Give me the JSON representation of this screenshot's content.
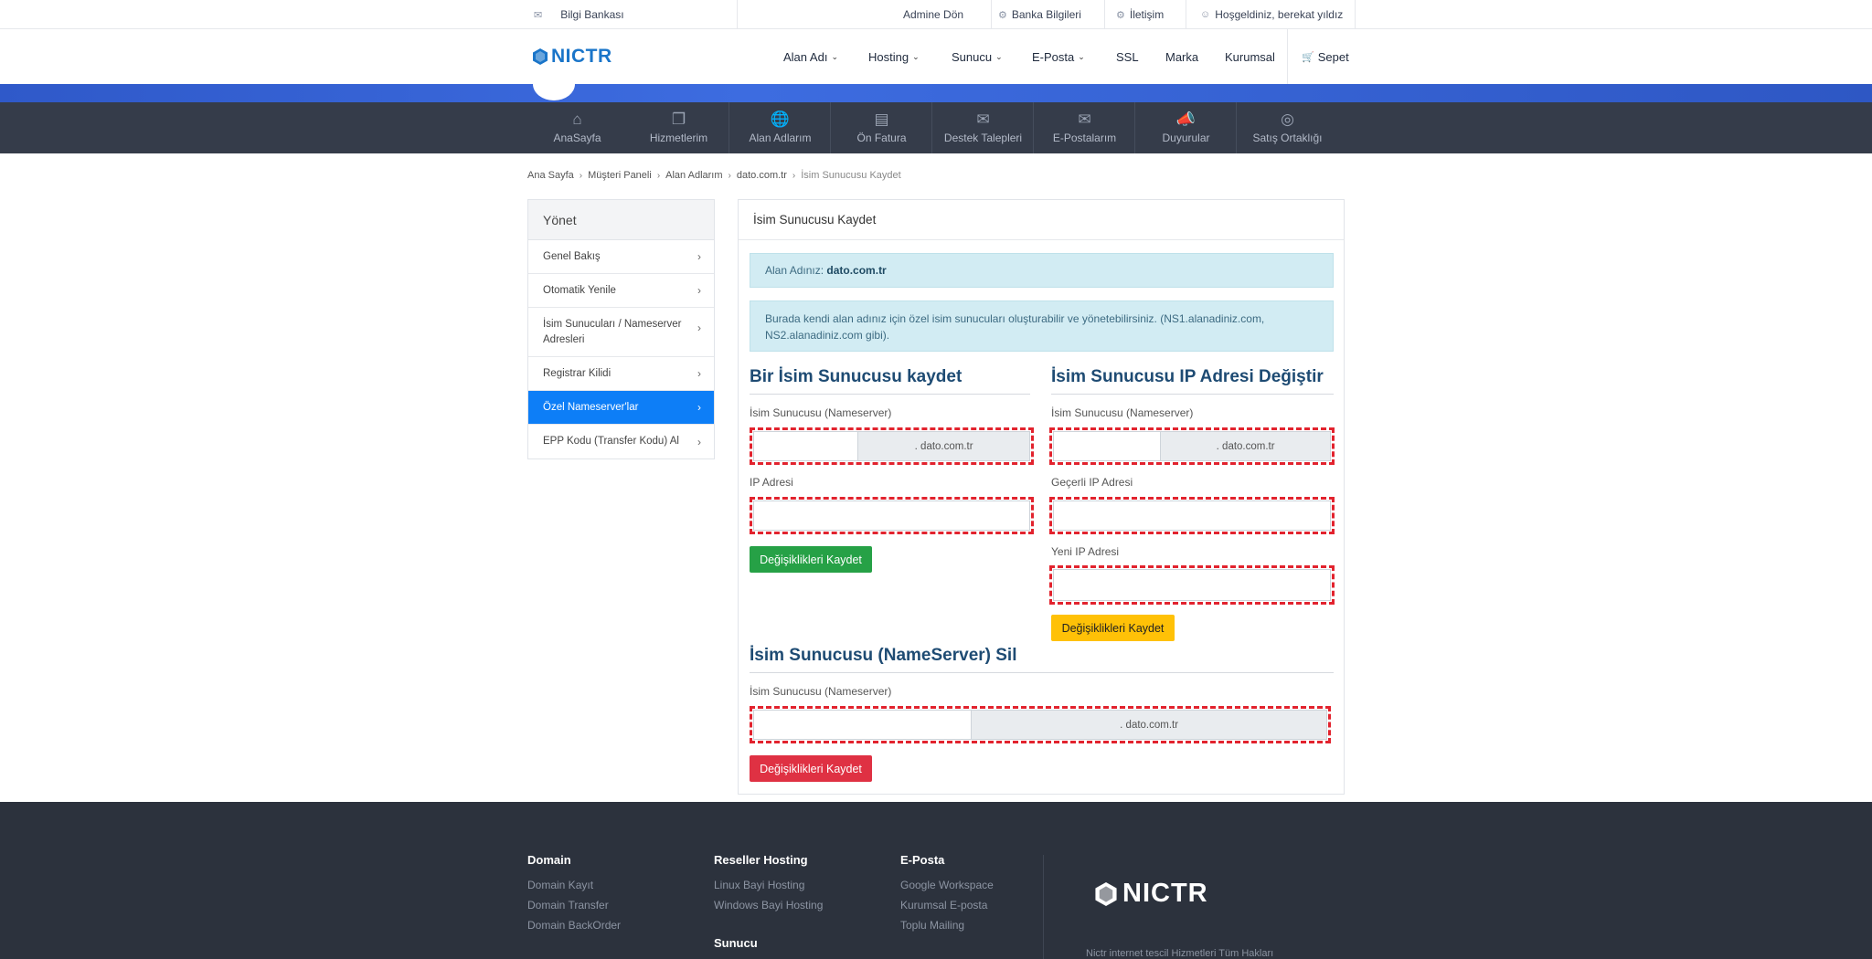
{
  "topbar": {
    "knowledge_base": "Bilgi Bankası",
    "admin_return": "Admine Dön",
    "bank_info": "Banka Bilgileri",
    "contact": "İletişim",
    "welcome": "Hoşgeldiniz, berekat yıldız"
  },
  "header": {
    "logo": "NICTR",
    "nav": [
      "Alan Adı",
      "Hosting",
      "Sunucu",
      "E-Posta",
      "SSL",
      "Marka",
      "Kurumsal"
    ],
    "cart": "Sepet"
  },
  "panel_nav": [
    {
      "label": "AnaSayfa",
      "icon": "home-icon"
    },
    {
      "label": "Hizmetlerim",
      "icon": "services-icon"
    },
    {
      "label": "Alan Adlarım",
      "icon": "globe-icon"
    },
    {
      "label": "Ön Fatura",
      "icon": "invoice-icon"
    },
    {
      "label": "Destek Talepleri",
      "icon": "support-icon"
    },
    {
      "label": "E-Postalarım",
      "icon": "mail-icon"
    },
    {
      "label": "Duyurular",
      "icon": "megaphone-icon"
    },
    {
      "label": "Satış Ortaklığı",
      "icon": "affiliate-icon"
    }
  ],
  "breadcrumb": [
    "Ana Sayfa",
    "Müşteri Paneli",
    "Alan Adlarım",
    "dato.com.tr",
    "İsim Sunucusu Kaydet"
  ],
  "sidebar": {
    "title": "Yönet",
    "items": [
      "Genel Bakış",
      "Otomatik Yenile",
      "İsim Sunucuları / Nameserver Adresleri",
      "Registrar Kilidi",
      "Özel Nameserver'lar",
      "EPP Kodu (Transfer Kodu) Al"
    ],
    "active_index": 4
  },
  "card": {
    "title": "İsim Sunucusu Kaydet",
    "domain_label": "Alan Adınız:",
    "domain": "dato.com.tr",
    "info": "Burada kendi alan adınız için özel isim sunucuları oluşturabilir ve yönetebilirsiniz. (NS1.alanadiniz.com, NS2.alanadiniz.com gibi).",
    "register": {
      "title": "Bir İsim Sunucusu kaydet",
      "ns_label": "İsim Sunucusu (Nameserver)",
      "ns_suffix": ". dato.com.tr",
      "ip_label": "IP Adresi",
      "button": "Değişiklikleri Kaydet"
    },
    "change_ip": {
      "title": "İsim Sunucusu IP Adresi Değiştir",
      "ns_label": "İsim Sunucusu (Nameserver)",
      "ns_suffix": ". dato.com.tr",
      "current_ip_label": "Geçerli IP Adresi",
      "new_ip_label": "Yeni IP Adresi",
      "button": "Değişiklikleri Kaydet"
    },
    "delete": {
      "title": "İsim Sunucusu (NameServer) Sil",
      "ns_label": "İsim Sunucusu (Nameserver)",
      "ns_suffix": ". dato.com.tr",
      "button": "Değişiklikleri Kaydet"
    }
  },
  "footer": {
    "col1": {
      "title": "Domain",
      "links": [
        "Domain Kayıt",
        "Domain Transfer",
        "Domain BackOrder"
      ]
    },
    "col2": {
      "title": "Reseller Hosting",
      "links": [
        "Linux Bayi Hosting",
        "Windows Bayi Hosting"
      ],
      "title2": "Sunucu"
    },
    "col3": {
      "title": "E-Posta",
      "links": [
        "Google Workspace",
        "Kurumsal E-posta",
        "Toplu Mailing"
      ]
    },
    "logo": "NICTR",
    "copyright": "Nictr internet tescil Hizmetleri Tüm Hakları"
  },
  "colors": {
    "accent": "#0d7ef7",
    "brand": "#1a75c9",
    "panel_bg": "#353c4a",
    "footer_bg": "#2c323d",
    "success": "#26a146",
    "warning": "#ffc107",
    "danger": "#df3143",
    "highlight": "#e2232e"
  }
}
